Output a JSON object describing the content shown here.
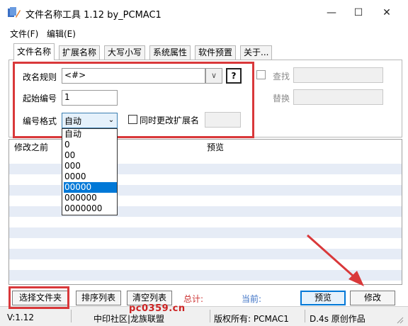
{
  "window": {
    "title": "文件名称工具 1.12   by_PCMAC1",
    "minimize_glyph": "—",
    "maximize_glyph": "☐",
    "close_glyph": "✕"
  },
  "menu": [
    "文件(F)",
    "编辑(E)"
  ],
  "tabs": [
    {
      "label": "文件名称",
      "active": true
    },
    {
      "label": "扩展名称",
      "active": false
    },
    {
      "label": "大写小写",
      "active": false
    },
    {
      "label": "系统属性",
      "active": false
    },
    {
      "label": "软件预置",
      "active": false
    },
    {
      "label": "关于...",
      "active": false
    }
  ],
  "form": {
    "rename_rule_label": "改名规则",
    "rename_rule_value": "<#>",
    "combo_arrow": "∨",
    "help_label": "?",
    "start_number_label": "起始编号",
    "start_number_value": "1",
    "number_format_label": "编号格式",
    "number_format_value": "自动",
    "select_arrow": "⌄",
    "also_change_ext_label": "同时更改扩展名",
    "find_label": "查找",
    "find_value": "",
    "replace_label": "替换",
    "replace_value": ""
  },
  "list": {
    "columns": [
      "修改之前",
      "预览"
    ]
  },
  "dropdown": {
    "options": [
      "自动",
      "0",
      "00",
      "000",
      "0000",
      "00000",
      "000000",
      "0000000"
    ],
    "selected_index": 5
  },
  "buttons": {
    "select_folder": "选择文件夹",
    "sort_list": "排序列表",
    "clear_list": "清空列表",
    "preview": "预览",
    "modify": "修改"
  },
  "stats": {
    "total_label": "总计:",
    "current_label": "当前:"
  },
  "statusbar": {
    "version": "V:1.12",
    "community": "中印社区|龙族联盟",
    "copyright": "版权所有: PCMAC1",
    "note": "D.4s 原创作品"
  },
  "watermark": "pc0359.cn",
  "colors": {
    "highlight_red": "#d9383a",
    "selection_blue": "#0078d7",
    "stat_label_red": "#cc3333",
    "stripe": "#e6ecf6"
  }
}
